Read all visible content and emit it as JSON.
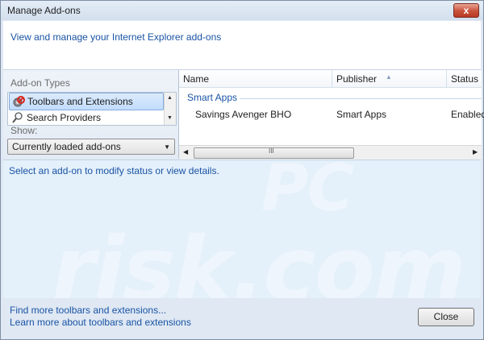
{
  "window": {
    "title": "Manage Add-ons",
    "close_glyph": "x"
  },
  "header": {
    "text": "View and manage your Internet Explorer add-ons"
  },
  "addon_types": {
    "label": "Add-on Types",
    "items": [
      {
        "label": "Toolbars and Extensions",
        "icon": "gear-icon",
        "selected": true
      },
      {
        "label": "Search Providers",
        "icon": "magnifier-icon",
        "selected": false
      }
    ]
  },
  "show": {
    "label": "Show:",
    "value": "Currently loaded add-ons"
  },
  "table": {
    "columns": [
      "Name",
      "Publisher",
      "Status"
    ],
    "group": "Smart Apps",
    "rows": [
      {
        "name": "Savings Avenger BHO",
        "publisher": "Smart Apps",
        "status": "Enabled"
      }
    ],
    "scroll_grip": "III"
  },
  "details": {
    "text": "Select an add-on to modify status or view details."
  },
  "watermark": {
    "line1": "PC",
    "line2": "risk.com"
  },
  "footer": {
    "link1": "Find more toolbars and extensions...",
    "link2": "Learn more about toolbars and extensions",
    "close_label": "Close"
  },
  "colors": {
    "link": "#1a54a4",
    "selection": "#c1dcfc",
    "panel": "#e4f0fa"
  }
}
